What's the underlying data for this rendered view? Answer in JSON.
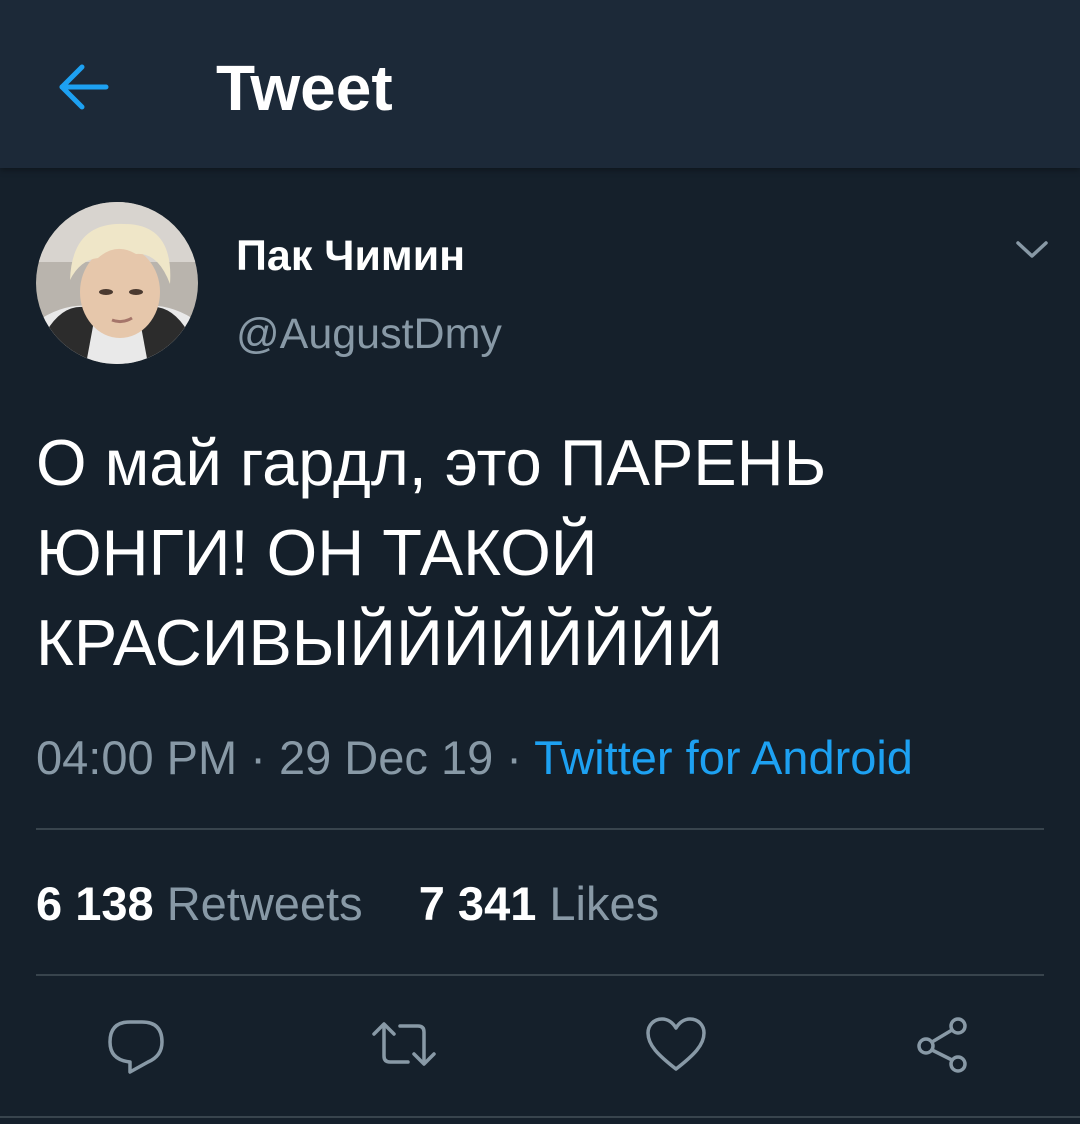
{
  "header": {
    "title": "Tweet",
    "back_icon": "arrow-left-icon",
    "accent_color": "#1da1f2"
  },
  "tweet": {
    "author": {
      "display_name": "Пак Чимин",
      "handle": "@AugustDmy",
      "avatar": "profile-photo"
    },
    "text": "О май гардл, это ПАРЕНЬ\nЮНГИ! ОН ТАКОЙ\nКРАСИВЫЙЙЙЙЙЙЙЙ",
    "time": "04:00 PM",
    "date": "29 Dec 19",
    "separator": "·",
    "source": "Twitter for Android",
    "retweets_count": "6 138",
    "retweets_label": "Retweets",
    "likes_count": "7 341",
    "likes_label": "Likes"
  },
  "actions": [
    {
      "icon": "reply-icon"
    },
    {
      "icon": "retweet-icon"
    },
    {
      "icon": "like-icon"
    },
    {
      "icon": "share-icon"
    }
  ],
  "colors": {
    "background": "#15202b",
    "header_background": "#1c2938",
    "secondary_text": "#8899a6",
    "divider": "#38444d"
  }
}
